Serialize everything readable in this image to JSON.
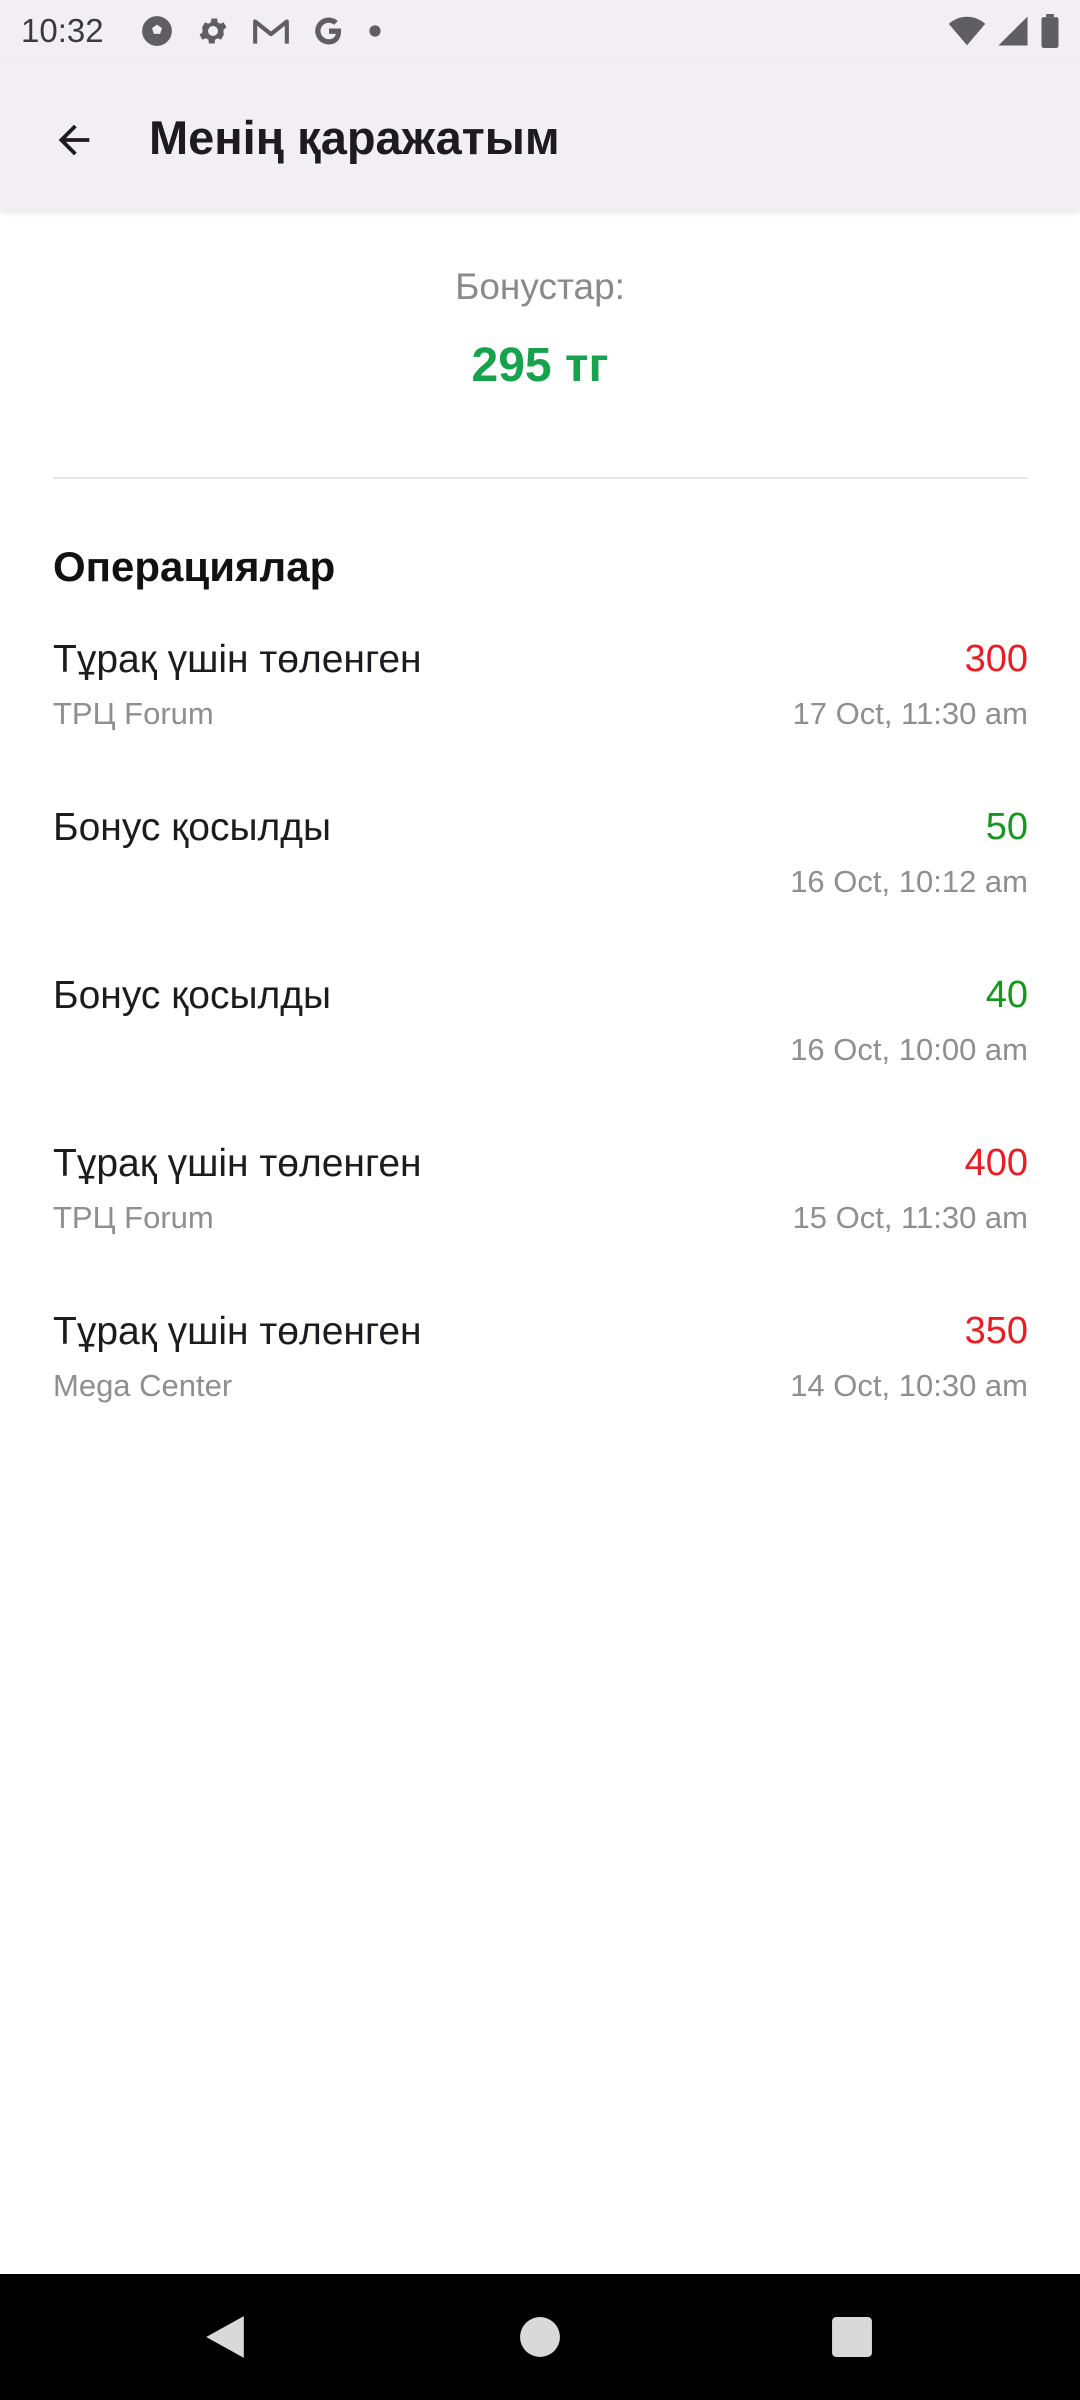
{
  "status_bar": {
    "time": "10:32",
    "left_icons": [
      "soccer-ball-icon",
      "gear-icon",
      "gmail-icon",
      "google-icon",
      "dot-icon"
    ],
    "right_icons": [
      "wifi-icon",
      "cellular-signal-icon",
      "battery-icon"
    ]
  },
  "app_bar": {
    "back_icon": "arrow-left-icon",
    "title": "Менің қаражатым"
  },
  "bonus": {
    "label": "Бонустар:",
    "value": "295 тг",
    "color": "#17a34e"
  },
  "operations": {
    "heading": "Операциялар",
    "items": [
      {
        "title": "Тұрақ үшін төленген",
        "place": "ТРЦ Forum",
        "amount": "300",
        "date": "17 Oct, 11:30 am",
        "kind": "debit"
      },
      {
        "title": "Бонус қосылды",
        "place": "",
        "amount": "50",
        "date": "16 Oct, 10:12 am",
        "kind": "credit"
      },
      {
        "title": "Бонус қосылды",
        "place": "",
        "amount": "40",
        "date": "16 Oct, 10:00 am",
        "kind": "credit"
      },
      {
        "title": "Тұрақ үшін төленген",
        "place": "ТРЦ Forum",
        "amount": "400",
        "date": "15 Oct, 11:30 am",
        "kind": "debit"
      },
      {
        "title": "Тұрақ үшін төленген",
        "place": "Mega Center",
        "amount": "350",
        "date": "14 Oct, 10:30 am",
        "kind": "debit"
      }
    ],
    "debit_color": "#ea1c24",
    "credit_color": "#17961f"
  },
  "nav_bar": {
    "buttons": [
      "back-triangle-icon",
      "home-circle-icon",
      "recents-square-icon"
    ]
  }
}
